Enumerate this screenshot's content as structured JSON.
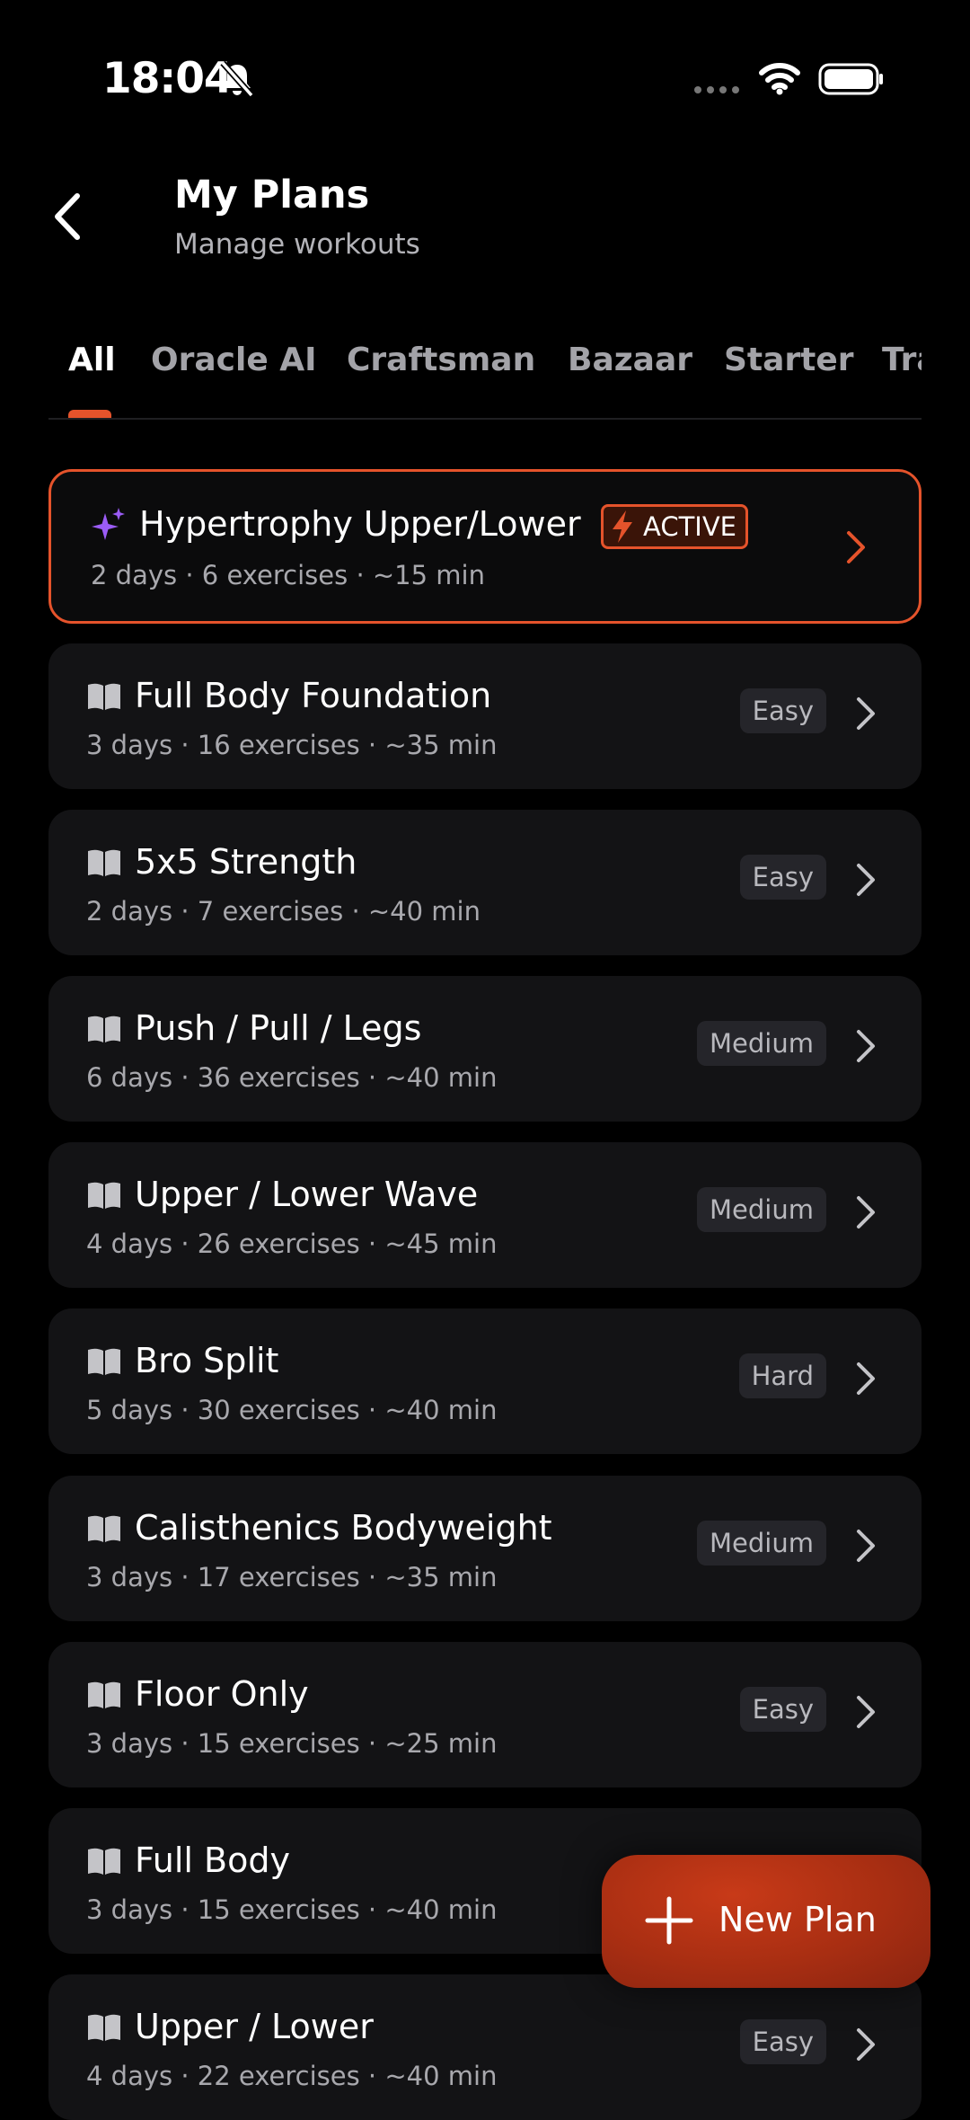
{
  "status_bar": {
    "time": "18:04"
  },
  "header": {
    "title": "My Plans",
    "subtitle": "Manage workouts"
  },
  "tabs": [
    {
      "label": "All"
    },
    {
      "label": "Oracle AI"
    },
    {
      "label": "Craftsman"
    },
    {
      "label": "Bazaar"
    },
    {
      "label": "Starter"
    },
    {
      "label": "Tra"
    }
  ],
  "active_plan": {
    "name": "Hypertrophy Upper/Lower",
    "meta": "2 days · 6 exercises · ~15 min",
    "badge": "ACTIVE"
  },
  "plans": [
    {
      "name": "Full Body Foundation",
      "meta": "3 days · 16 exercises · ~35 min",
      "difficulty": "Easy"
    },
    {
      "name": "5x5 Strength",
      "meta": "2 days · 7 exercises · ~40 min",
      "difficulty": "Easy"
    },
    {
      "name": "Push / Pull / Legs",
      "meta": "6 days · 36 exercises · ~40 min",
      "difficulty": "Medium"
    },
    {
      "name": "Upper / Lower Wave",
      "meta": "4 days · 26 exercises · ~45 min",
      "difficulty": "Medium"
    },
    {
      "name": "Bro Split",
      "meta": "5 days · 30 exercises · ~40 min",
      "difficulty": "Hard"
    },
    {
      "name": "Calisthenics Bodyweight",
      "meta": "3 days · 17 exercises · ~35 min",
      "difficulty": "Medium"
    },
    {
      "name": "Floor Only",
      "meta": "3 days · 15 exercises · ~25 min",
      "difficulty": "Easy"
    },
    {
      "name": "Full Body",
      "meta": "3 days · 15 exercises · ~40 min",
      "difficulty": ""
    },
    {
      "name": "Upper / Lower",
      "meta": "4 days · 22 exercises · ~40 min",
      "difficulty": "Easy"
    }
  ],
  "fab": {
    "label": "New Plan"
  },
  "colors": {
    "accent": "#e5532b",
    "card": "#131315",
    "ai_icon": "#9b5cf6"
  }
}
